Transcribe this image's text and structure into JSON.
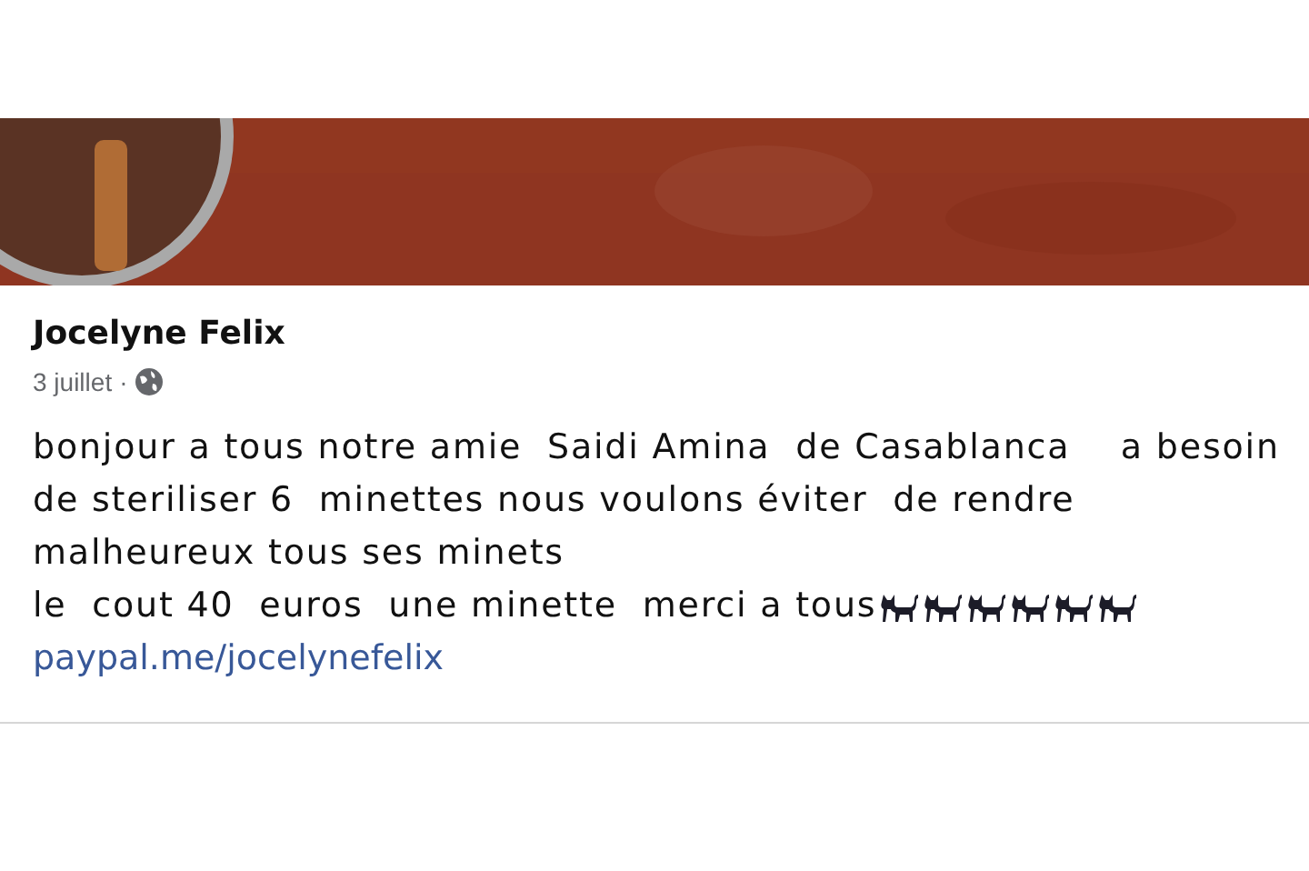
{
  "post": {
    "author": "Jocelyne Felix",
    "date": "3 juillet",
    "separator": "·",
    "paragraphs": [
      "bonjour a tous notre amie  Saidi Amina  de Casablanca    a besoin de steriliser 6  minettes nous voulons éviter  de rendre malheureux tous ses minets",
      "le  cout 40  euros  une minette  merci a tous"
    ],
    "link": "paypal.me/jocelynefelix"
  }
}
